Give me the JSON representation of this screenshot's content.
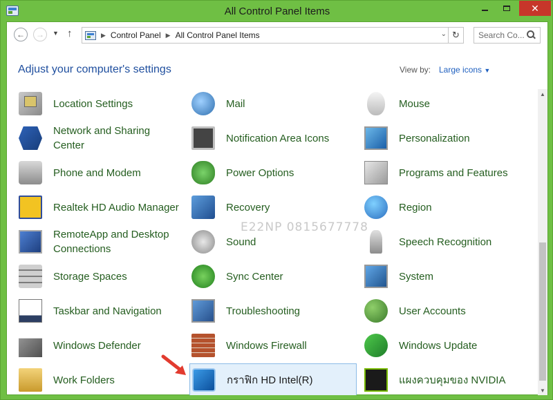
{
  "window": {
    "title": "All Control Panel Items"
  },
  "nav": {
    "breadcrumbs": [
      "Control Panel",
      "All Control Panel Items"
    ],
    "search_placeholder": "Search Co..."
  },
  "header": {
    "heading": "Adjust your computer's settings",
    "viewby_label": "View by:",
    "viewby_value": "Large icons"
  },
  "items": [
    {
      "label": "Location Settings",
      "icon": "location-icon"
    },
    {
      "label": "Mail",
      "icon": "mail-icon"
    },
    {
      "label": "Mouse",
      "icon": "mouse-icon"
    },
    {
      "label": "Network and Sharing\nCenter",
      "icon": "network-icon"
    },
    {
      "label": "Notification Area Icons",
      "icon": "notification-icon"
    },
    {
      "label": "Personalization",
      "icon": "personalization-icon"
    },
    {
      "label": "Phone and Modem",
      "icon": "phone-icon"
    },
    {
      "label": "Power Options",
      "icon": "power-icon"
    },
    {
      "label": "Programs and Features",
      "icon": "programs-icon"
    },
    {
      "label": "Realtek HD Audio Manager",
      "icon": "realtek-icon"
    },
    {
      "label": "Recovery",
      "icon": "recovery-icon"
    },
    {
      "label": "Region",
      "icon": "region-icon"
    },
    {
      "label": "RemoteApp and Desktop\nConnections",
      "icon": "remoteapp-icon"
    },
    {
      "label": "Sound",
      "icon": "sound-icon"
    },
    {
      "label": "Speech Recognition",
      "icon": "speech-icon"
    },
    {
      "label": "Storage Spaces",
      "icon": "storage-icon"
    },
    {
      "label": "Sync Center",
      "icon": "sync-icon"
    },
    {
      "label": "System",
      "icon": "system-icon"
    },
    {
      "label": "Taskbar and Navigation",
      "icon": "taskbar-icon"
    },
    {
      "label": "Troubleshooting",
      "icon": "troubleshooting-icon"
    },
    {
      "label": "User Accounts",
      "icon": "user-accounts-icon"
    },
    {
      "label": "Windows Defender",
      "icon": "defender-icon"
    },
    {
      "label": "Windows Firewall",
      "icon": "firewall-icon"
    },
    {
      "label": "Windows Update",
      "icon": "update-icon"
    },
    {
      "label": "Work Folders",
      "icon": "work-folders-icon"
    },
    {
      "label": "กราฟิก HD Intel(R)",
      "icon": "intel-graphics-icon",
      "selected": true
    },
    {
      "label": "แผงควบคุมของ NVIDIA",
      "icon": "nvidia-icon"
    }
  ],
  "watermark": "E22NP 0815677778",
  "colors": {
    "frame": "#6fbf44",
    "heading": "#1e4e9e",
    "item_label": "#245d1f",
    "selected_bg": "#e3f0fb",
    "close_button": "#c7362a",
    "arrow": "#e23b2f"
  }
}
